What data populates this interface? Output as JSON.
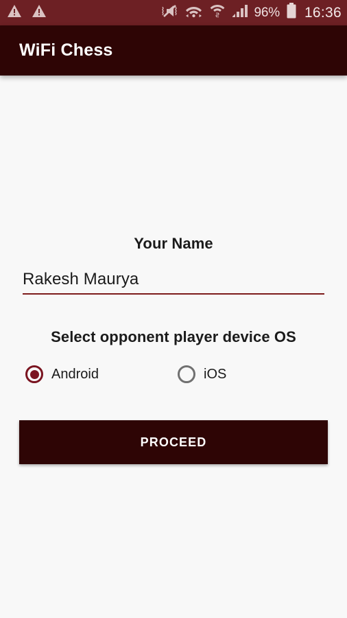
{
  "status_bar": {
    "icons": [
      "warning-triangle-icon",
      "warning-triangle-icon",
      "volume-muted-icon",
      "wifi-data-transfer-icon",
      "wifi-hotspot-icon",
      "cellular-signal-icon"
    ],
    "battery_percent": "96%",
    "time": "16:36",
    "background_color": "#6d2024"
  },
  "app_bar": {
    "title": "WiFi Chess",
    "background_color": "#2e0505",
    "text_color": "#ffffff"
  },
  "form": {
    "name_label": "Your Name",
    "name_value": "Rakesh Maurya",
    "name_placeholder": "Your Name",
    "name_underline_color": "#7d1b1b",
    "os_label": "Select opponent player device OS",
    "radio_options": [
      {
        "label": "Android",
        "selected": true
      },
      {
        "label": "iOS",
        "selected": false
      }
    ],
    "selected_os": "Android",
    "accent_color": "#7a1420",
    "unselected_color": "#707070"
  },
  "actions": {
    "proceed_label": "PROCEED",
    "proceed_bg": "#2e0505"
  },
  "page": {
    "background_color": "#f8f8f8"
  }
}
